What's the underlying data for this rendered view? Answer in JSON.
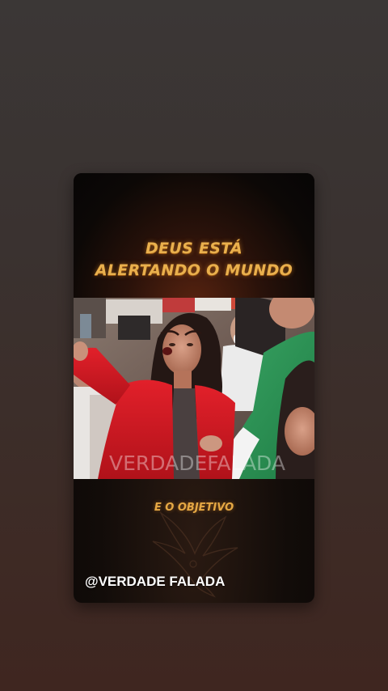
{
  "story": {
    "headline_line1": "DEUS ESTÁ",
    "headline_line2": "ALERTANDO O MUNDO",
    "photo_watermark": "VERDADEFALADA",
    "caption": "E O OBJETIVO",
    "handle": "@VERDADE FALADA"
  },
  "colors": {
    "headline": "#e9b04d",
    "caption": "#e5a844",
    "background": "#3b3736"
  },
  "icons": {
    "photo": "protest-photo",
    "decoration": "bird-silhouette-icon"
  }
}
